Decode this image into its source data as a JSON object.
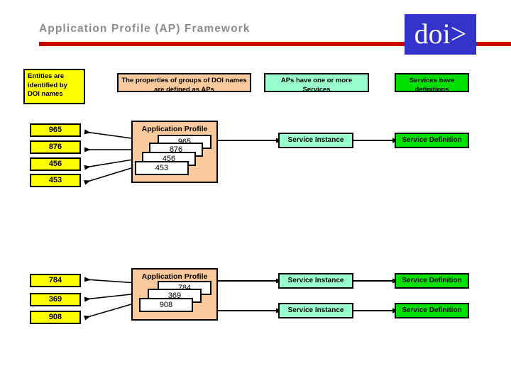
{
  "header": {
    "title": "Application Profile (AP) Framework",
    "logo_text": "doi>",
    "logo_color": "#3333CC",
    "rule_color": "#CC0000",
    "title_color": "#8C8C8C"
  },
  "legend": {
    "entities": "Entities are identified by DOI names",
    "properties": "The properties of groups of DOI names are defined as APs",
    "aps": "APs have one or more Services",
    "services": "Services have definitions"
  },
  "colors": {
    "yellow": "#FFFF00",
    "peach": "#FBCA9C",
    "mint": "#99FFCC",
    "green": "#00E000",
    "white": "#FFFFFF",
    "border": "#000000"
  },
  "groups": [
    {
      "name": "group-1",
      "ap_title": "Application Profile",
      "ids": [
        "965",
        "876",
        "456",
        "453"
      ],
      "profile_entries": [
        "965",
        "876",
        "456",
        "453"
      ],
      "services": [
        {
          "instance": "Service Instance",
          "definition": "Service Definition"
        }
      ]
    },
    {
      "name": "group-2",
      "ap_title": "Application Profile",
      "ids": [
        "784",
        "369",
        "908"
      ],
      "profile_entries": [
        "784",
        "369",
        "908"
      ],
      "services": [
        {
          "instance": "Service Instance",
          "definition": "Service Definition"
        },
        {
          "instance": "Service Instance",
          "definition": "Service Definition"
        }
      ]
    }
  ]
}
